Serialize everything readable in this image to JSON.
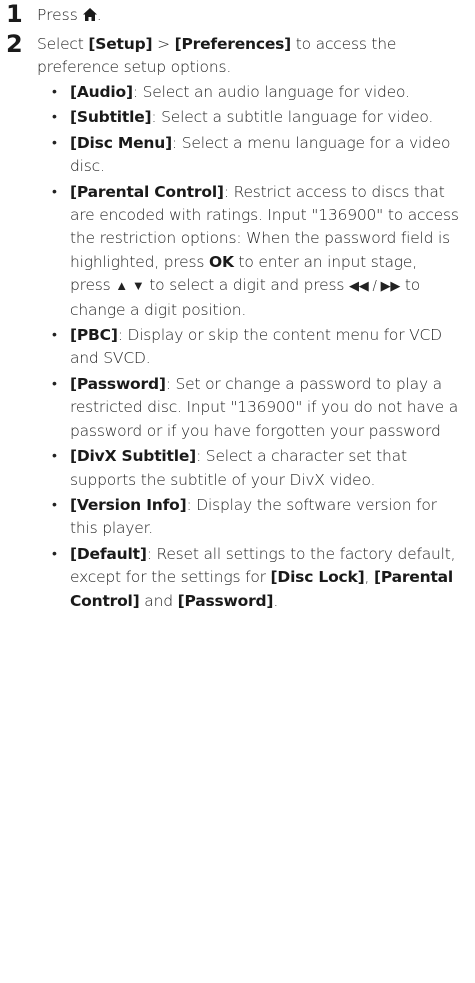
{
  "steps": [
    {
      "number": "1",
      "text_pre": "Press ",
      "text_post": "."
    },
    {
      "number": "2",
      "text": {
        "pre": "Select ",
        "setup": "[Setup]",
        "sep": " > ",
        "prefs": "[Preferences]",
        "post": " to access the preference setup options."
      }
    }
  ],
  "items": [
    {
      "label": "[Audio]",
      "desc": ": Select an audio language for video."
    },
    {
      "label": "[Subtitle]",
      "desc": ": Select a subtitle language for video."
    },
    {
      "label": "[Disc Menu]",
      "desc": ": Select a menu language for a video disc."
    },
    {
      "label": "[Parental Control]",
      "desc_a": ": Restrict access to discs that are encoded with ratings. Input \"136900\" to access the restriction options: When the password field is highlighted, press ",
      "ok": "OK",
      "desc_b": " to enter an input stage, press ",
      "updown": "▲ ▼",
      "desc_c": " to select a digit and press ",
      "leftright": "◀◀ / ▶▶",
      "desc_d": " to change a digit position."
    },
    {
      "label": "[PBC]",
      "desc": ": Display or skip the content menu for VCD and SVCD."
    },
    {
      "label": "[Password]",
      "desc": ": Set or change a password to play a restricted disc. Input \"136900\" if you do not have a password or if you have forgotten your password"
    },
    {
      "label": "[DivX Subtitle]",
      "desc": ": Select a character set that supports the subtitle of your DivX video."
    },
    {
      "label": "[Version Info]",
      "desc": ": Display the software version for this player."
    },
    {
      "label": "[Default]",
      "desc_a": ": Reset all settings to the factory default, except for the settings for ",
      "disc_lock": "[Disc Lock]",
      "comma": ", ",
      "parental": "[Parental Control]",
      "and": " and ",
      "password": "[Password]",
      "end": "."
    }
  ],
  "icons": {
    "home": "home-icon",
    "bullet": "•"
  }
}
